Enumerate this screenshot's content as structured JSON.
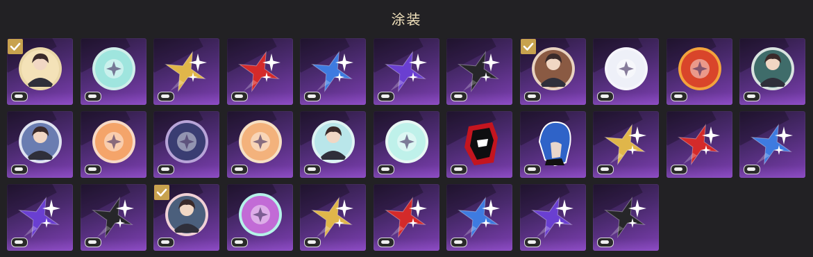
{
  "header": {
    "title": "涂装"
  },
  "colors": {
    "accent_gold": "#c8a24e",
    "tile_gradient_start": "#2a1a3c",
    "tile_gradient_end": "#7d3fb2",
    "page_background": "#222124"
  },
  "skins": [
    {
      "art": "portrait-avatar-icon",
      "variant": "portrait",
      "bg": "#f4e2b8",
      "ring": "#ead7a8",
      "selected": true
    },
    {
      "art": "teal-disc-icon",
      "variant": "disc",
      "bg": "#9fe5de",
      "ring": "#cfeeea",
      "selected": false
    },
    {
      "art": "gold-star-icon",
      "variant": "star",
      "color": "#e0b64a",
      "selected": false
    },
    {
      "art": "red-star-icon",
      "variant": "star",
      "color": "#d42a2a",
      "selected": false
    },
    {
      "art": "blue-star-icon",
      "variant": "star",
      "color": "#3e7be0",
      "selected": false
    },
    {
      "art": "purple-star-icon",
      "variant": "star",
      "color": "#6a3fd1",
      "selected": false
    },
    {
      "art": "black-star-icon",
      "variant": "star",
      "color": "#262629",
      "selected": false
    },
    {
      "art": "group-portrait-icon",
      "variant": "portrait",
      "bg": "#8a5a43",
      "ring": "#e8d2c0",
      "selected": true
    },
    {
      "art": "emblem-disc-icon",
      "variant": "disc",
      "bg": "#eef0f8",
      "ring": "#f5f5fb",
      "selected": false
    },
    {
      "art": "fire-creature-icon",
      "variant": "disc",
      "bg": "#d9452a",
      "ring": "#f3a33d",
      "selected": false
    },
    {
      "art": "mask-character-icon",
      "variant": "portrait",
      "bg": "#3f6c6a",
      "ring": "#d9e3e0",
      "selected": false
    },
    {
      "art": "chibi-character-icon",
      "variant": "portrait",
      "bg": "#6a7db1",
      "ring": "#dfe3f0",
      "selected": false
    },
    {
      "art": "colorful-emblem-icon",
      "variant": "disc",
      "bg": "#f4a46a",
      "ring": "#f7d9c6",
      "selected": false
    },
    {
      "art": "starburst-disc-icon",
      "variant": "disc",
      "bg": "#3a3d72",
      "ring": "#b8a4d8",
      "selected": false
    },
    {
      "art": "crystal-creature-icon",
      "variant": "disc",
      "bg": "#f3b27c",
      "ring": "#f6e0c4",
      "selected": false
    },
    {
      "art": "blonde-character-icon",
      "variant": "portrait",
      "bg": "#b9e6ea",
      "ring": "#dff3f3",
      "selected": false
    },
    {
      "art": "pastel-emblem-icon",
      "variant": "disc",
      "bg": "#bff1ea",
      "ring": "#e8f7f4",
      "selected": false
    },
    {
      "art": "mask-silhouette-icon",
      "variant": "mask",
      "color": "#c4151f",
      "selected": false
    },
    {
      "art": "blue-hair-character-icon",
      "variant": "hair",
      "color": "#2f63c8",
      "selected": false
    },
    {
      "art": "gold-star-icon",
      "variant": "star",
      "color": "#e0b64a",
      "selected": false
    },
    {
      "art": "red-star-icon",
      "variant": "star",
      "color": "#d42a2a",
      "selected": false
    },
    {
      "art": "blue-star-icon",
      "variant": "star",
      "color": "#3e7be0",
      "selected": false
    },
    {
      "art": "purple-star-icon",
      "variant": "star",
      "color": "#6a3fd1",
      "selected": false
    },
    {
      "art": "black-star-icon",
      "variant": "star",
      "color": "#262629",
      "selected": false
    },
    {
      "art": "dark-character-icon",
      "variant": "portrait",
      "bg": "#4b5f7c",
      "ring": "#f1d1d6",
      "selected": true
    },
    {
      "art": "pink-cat-icon",
      "variant": "disc",
      "bg": "#c26bd6",
      "ring": "#b5f3e9",
      "selected": false
    },
    {
      "art": "gold-star-icon",
      "variant": "star",
      "color": "#e0b64a",
      "selected": false
    },
    {
      "art": "red-star-icon",
      "variant": "star",
      "color": "#d42a2a",
      "selected": false
    },
    {
      "art": "blue-star-icon",
      "variant": "star",
      "color": "#3e7be0",
      "selected": false
    },
    {
      "art": "purple-star-icon",
      "variant": "star",
      "color": "#6a3fd1",
      "selected": false
    },
    {
      "art": "black-star-icon",
      "variant": "star",
      "color": "#262629",
      "selected": false
    }
  ]
}
